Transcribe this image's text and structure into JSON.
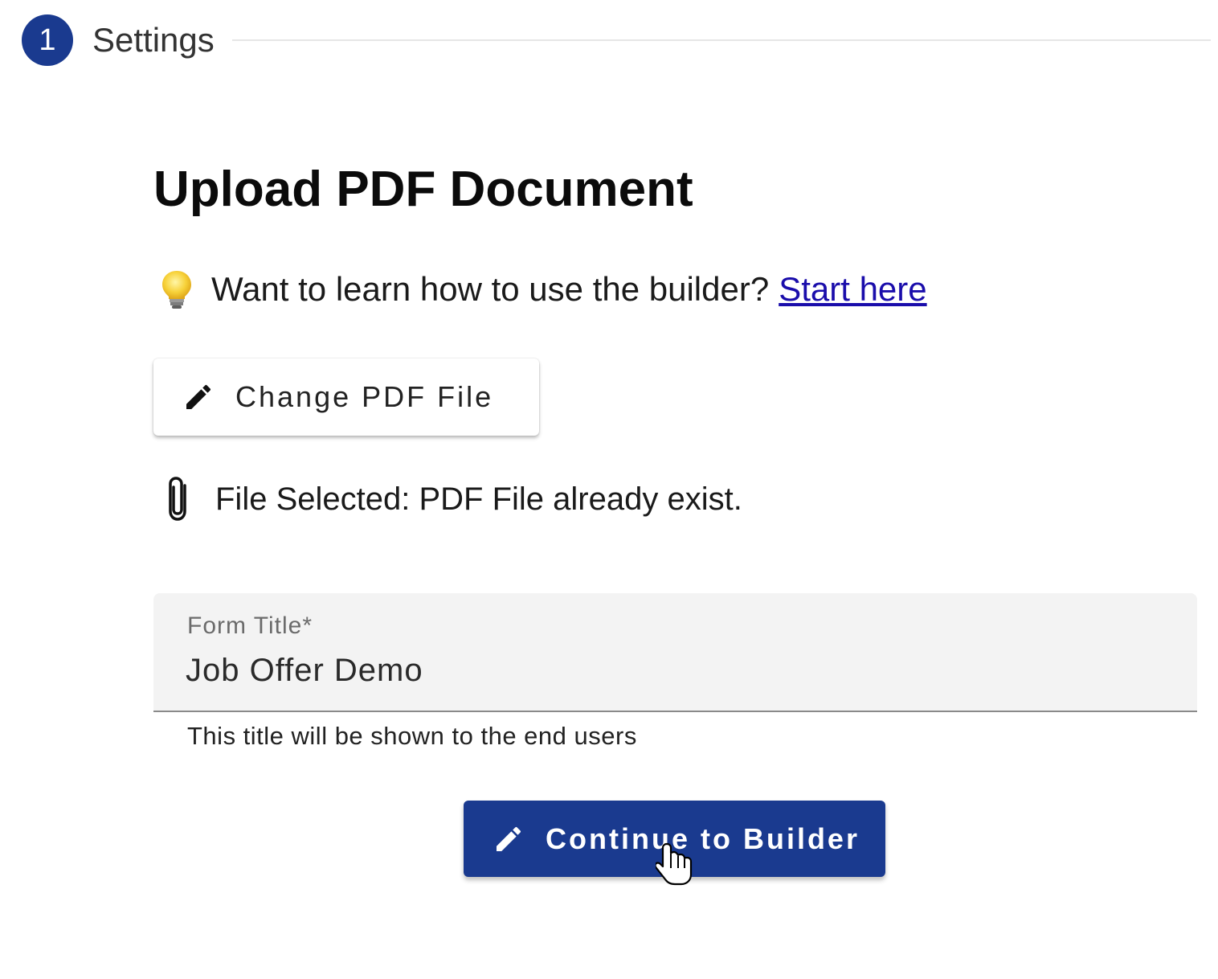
{
  "stepper": {
    "step_number": "1",
    "step_label": "Settings"
  },
  "page": {
    "title": "Upload PDF Document"
  },
  "help": {
    "icon": "lightbulb-icon",
    "text": "Want to learn how to use the builder?",
    "link_text": "Start here"
  },
  "change_button": {
    "icon": "pencil-icon",
    "label": "Change PDF File"
  },
  "file_status": {
    "icon": "paperclip-icon",
    "text": "File Selected: PDF File already exist."
  },
  "form_title_field": {
    "label": "Form Title*",
    "value": "Job Offer Demo",
    "helper": "This title will be shown to the end users"
  },
  "continue_button": {
    "icon": "pencil-icon",
    "label": "Continue to Builder"
  },
  "colors": {
    "primary": "#1a3a8f",
    "link": "#1a0dab",
    "field_bg": "#f3f3f3"
  }
}
